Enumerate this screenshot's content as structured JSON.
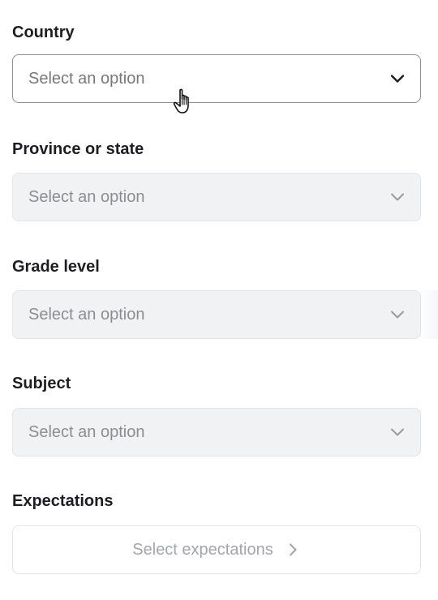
{
  "form": {
    "fields": [
      {
        "label": "Country",
        "placeholder": "Select an option",
        "state": "enabled",
        "icon": "chevron-down-icon"
      },
      {
        "label": "Province or state",
        "placeholder": "Select an option",
        "state": "disabled",
        "icon": "chevron-down-icon"
      },
      {
        "label": "Grade level",
        "placeholder": "Select an option",
        "state": "disabled",
        "icon": "chevron-down-icon"
      },
      {
        "label": "Subject",
        "placeholder": "Select an option",
        "state": "disabled",
        "icon": "chevron-down-icon"
      }
    ],
    "expectations": {
      "label": "Expectations",
      "button_label": "Select expectations",
      "icon": "chevron-right-icon"
    }
  },
  "cursor": {
    "icon": "hand-pointer-icon"
  },
  "colors": {
    "text": "#1d1d22",
    "placeholder": "#77787e",
    "disabled_bg": "#f1f2f3",
    "enabled_border": "#8e8e95",
    "muted": "#a4a5aa"
  }
}
